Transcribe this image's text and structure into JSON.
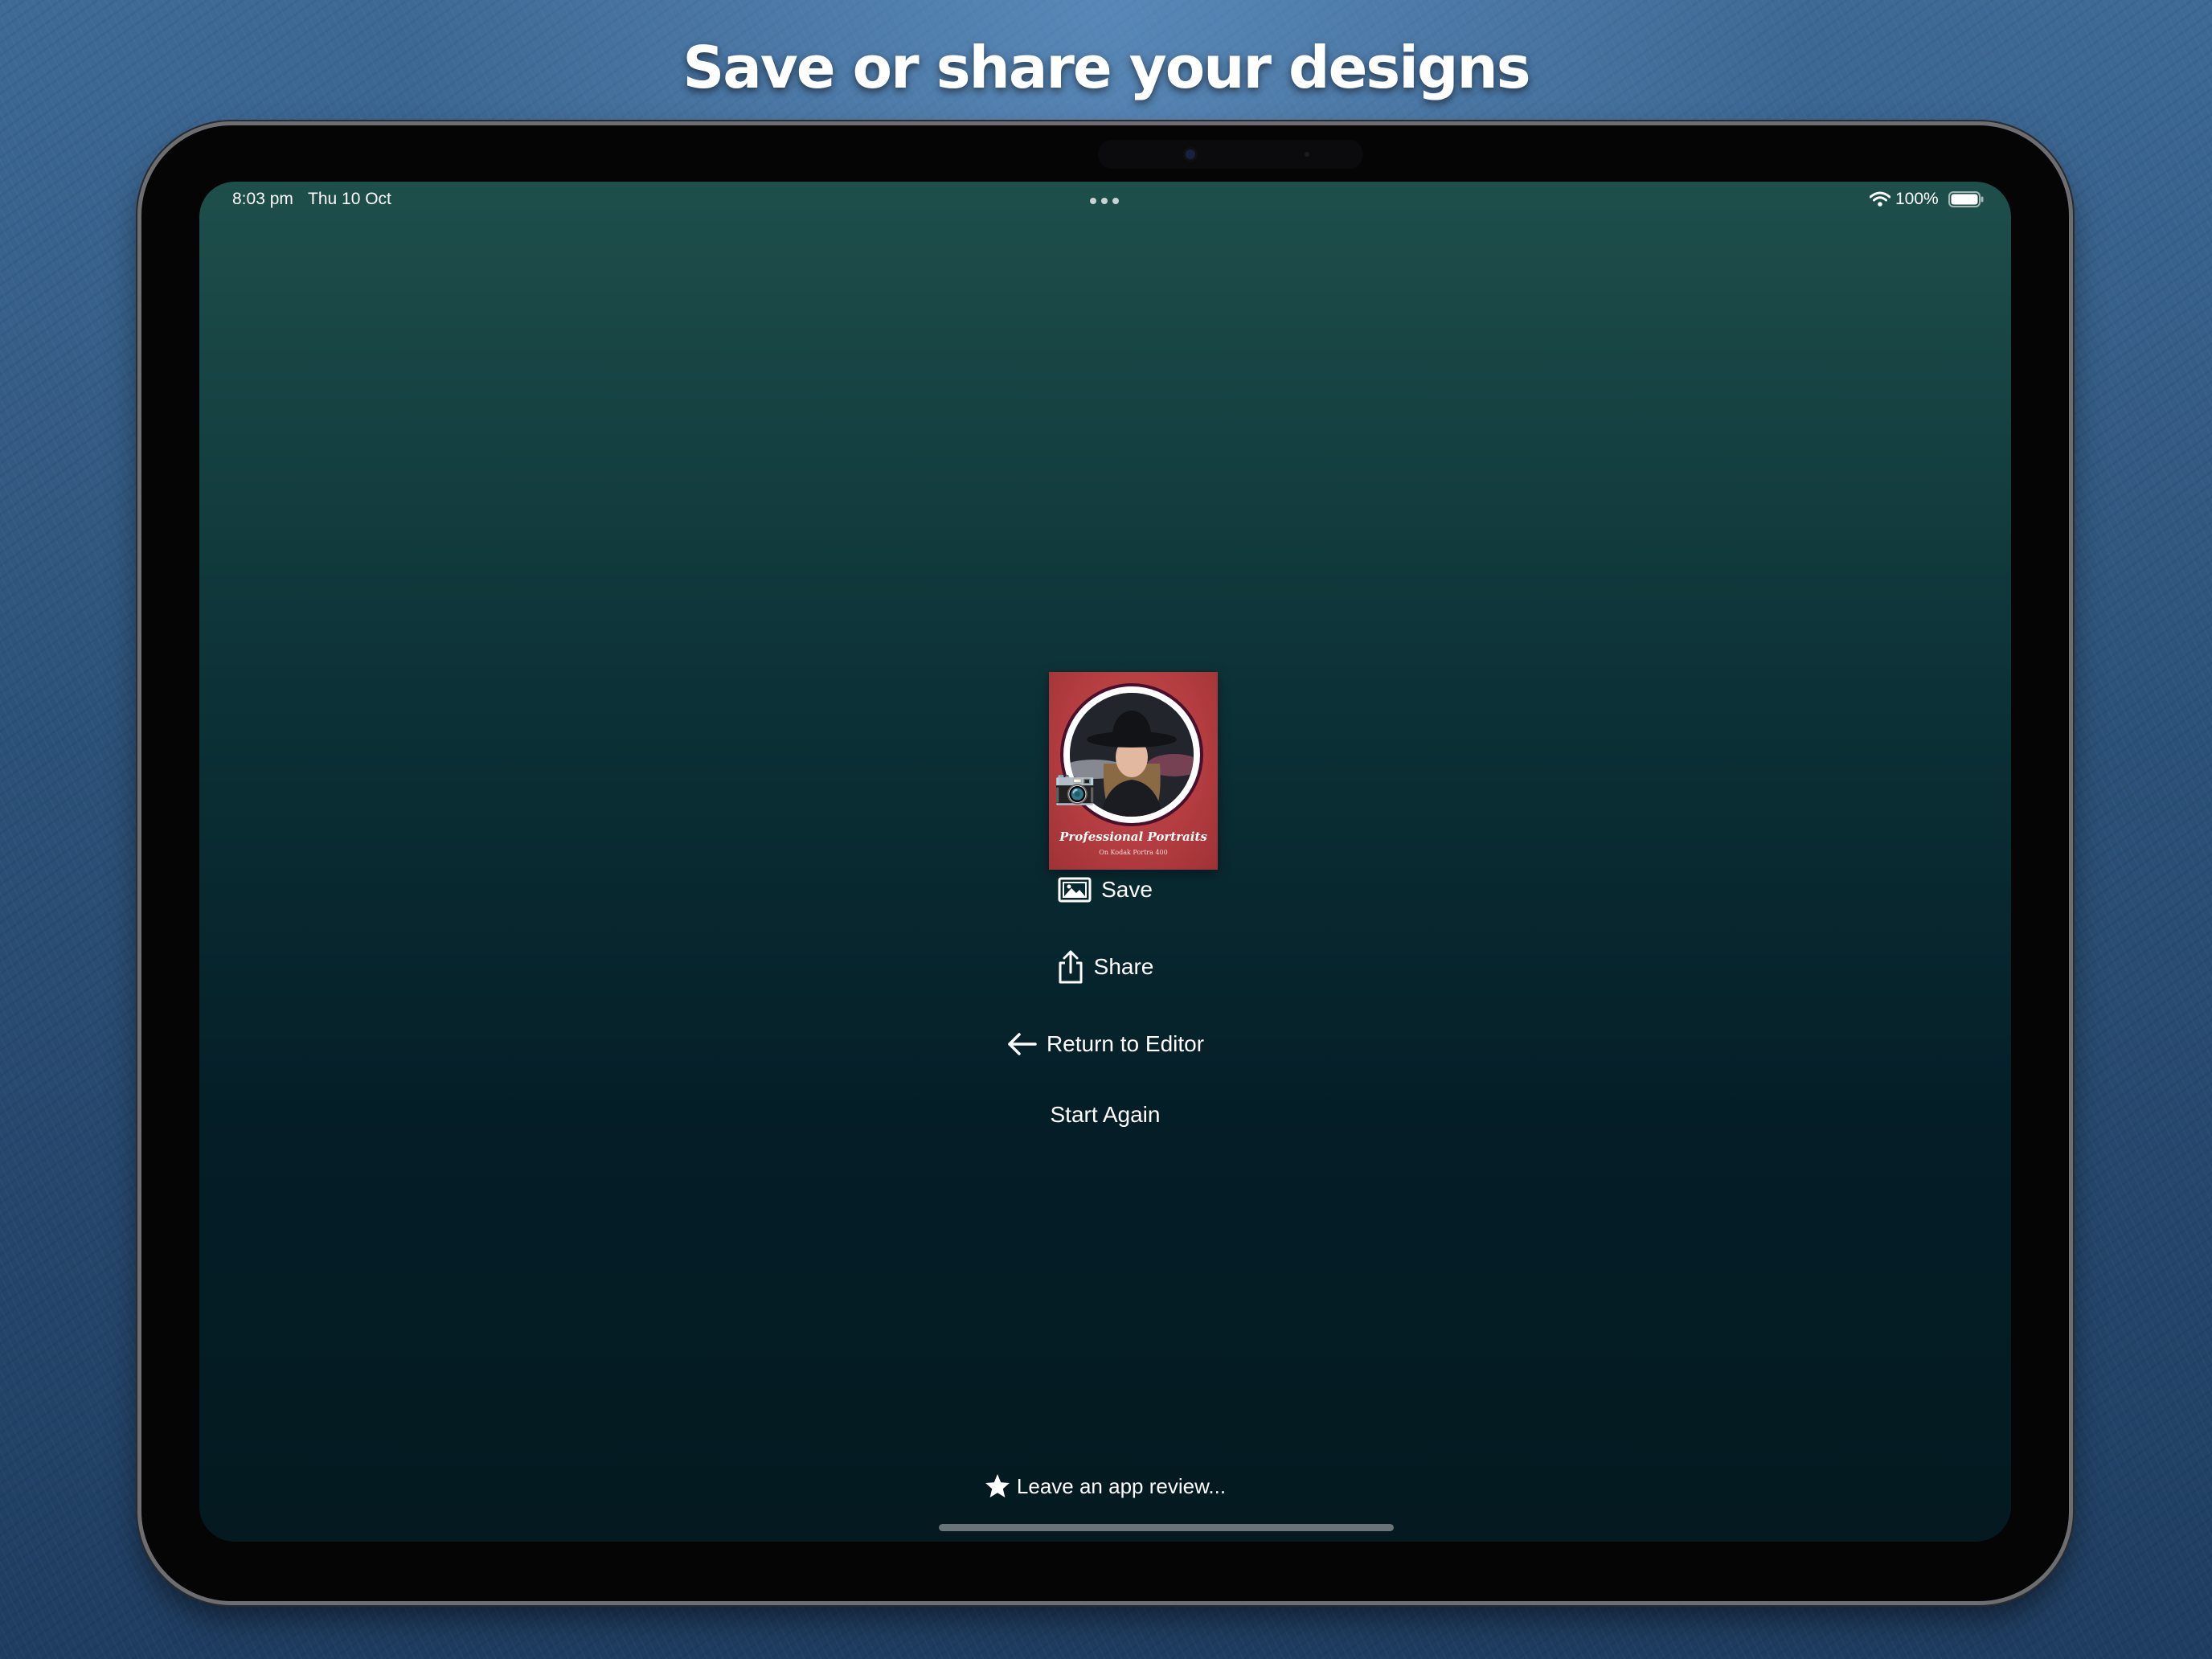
{
  "headline": "Save or share your designs",
  "status_bar": {
    "time": "8:03 pm",
    "date": "Thu 10 Oct",
    "battery": "100%",
    "icons": [
      "wifi-icon",
      "battery-icon"
    ]
  },
  "design_preview": {
    "title": "Professional Portraits",
    "subtitle": "On Kodak Portra 400",
    "background_color": "#b23c3f"
  },
  "actions": {
    "save": {
      "label": "Save",
      "icon": "photo-icon"
    },
    "share": {
      "label": "Share",
      "icon": "share-icon"
    },
    "return_to_editor": {
      "label": "Return to Editor",
      "icon": "arrow-left-icon"
    },
    "start_again": {
      "label": "Start Again"
    }
  },
  "review_link": {
    "label": "Leave an app review...",
    "icon": "star-icon"
  },
  "colors": {
    "screen_top": "#1e4f4b",
    "screen_bottom": "#041a20",
    "text": "#ffffff"
  }
}
